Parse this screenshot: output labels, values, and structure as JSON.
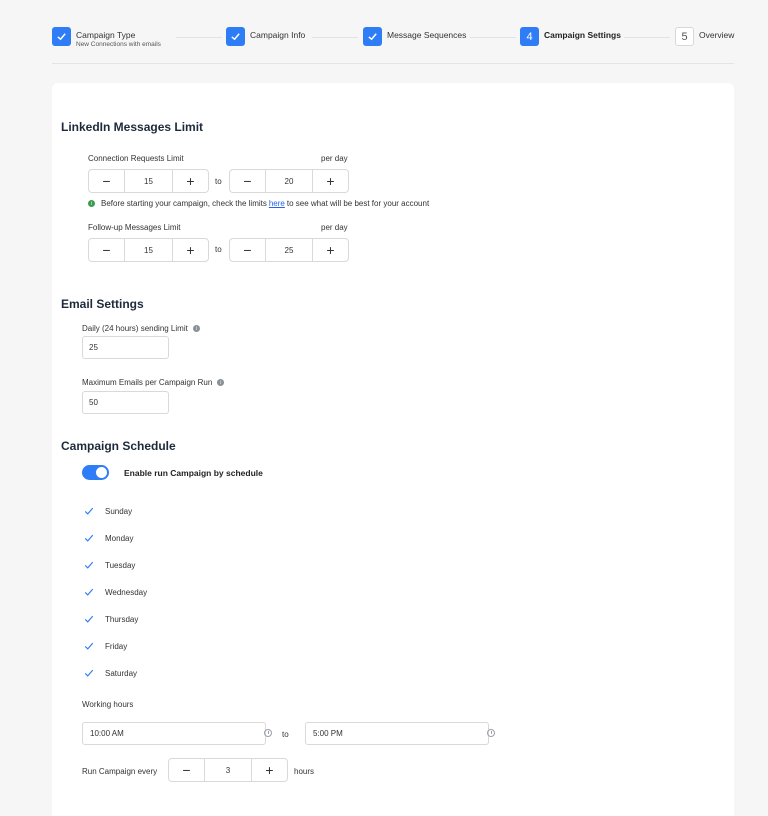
{
  "stepper": {
    "steps": [
      {
        "label": "Campaign Type",
        "sub": "New Connections with emails",
        "status": "done"
      },
      {
        "label": "Campaign Info",
        "status": "done"
      },
      {
        "label": "Message Sequences",
        "status": "done"
      },
      {
        "label": "Campaign Settings",
        "number": "4",
        "status": "active"
      },
      {
        "label": "Overview",
        "number": "5",
        "status": "pending"
      }
    ]
  },
  "linkedin": {
    "title": "LinkedIn Messages Limit",
    "connection": {
      "label": "Connection Requests Limit",
      "per_day": "per day",
      "min": "15",
      "to": "to",
      "max": "20"
    },
    "info": {
      "before": "Before starting your campaign, check the limits",
      "link": "here",
      "after": "to see what will be best for your account"
    },
    "followup": {
      "label": "Follow-up Messages Limit",
      "per_day": "per day",
      "min": "15",
      "to": "to",
      "max": "25"
    }
  },
  "email": {
    "title": "Email Settings",
    "daily_label": "Daily (24 hours) sending Limit",
    "daily_value": "25",
    "max_label": "Maximum Emails per Campaign Run",
    "max_value": "50"
  },
  "schedule": {
    "title": "Campaign Schedule",
    "toggle_label": "Enable run Campaign by schedule",
    "toggle_on": true,
    "days": [
      "Sunday",
      "Monday",
      "Tuesday",
      "Wednesday",
      "Thursday",
      "Friday",
      "Saturday"
    ],
    "working_hours_label": "Working hours",
    "start_time": "10:00 AM",
    "to": "to",
    "end_time": "5:00 PM",
    "run_every_label": "Run Campaign every",
    "run_every_value": "3",
    "hours_label": "hours"
  },
  "colors": {
    "accent": "#2f7df6",
    "info": "#3a9c4f",
    "link": "#2563eb"
  }
}
